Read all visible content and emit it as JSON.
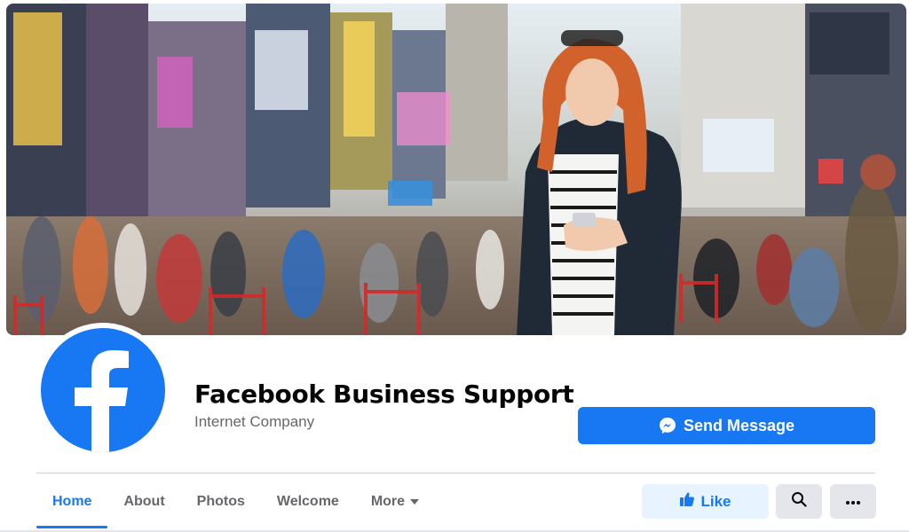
{
  "page": {
    "name": "Facebook Business Support",
    "category": "Internet Company"
  },
  "actions": {
    "send_message": "Send Message",
    "like": "Like"
  },
  "tabs": [
    {
      "label": "Home",
      "active": true
    },
    {
      "label": "About",
      "active": false
    },
    {
      "label": "Photos",
      "active": false
    },
    {
      "label": "Welcome",
      "active": false
    },
    {
      "label": "More",
      "active": false
    }
  ],
  "icons": {
    "send": "messenger-icon",
    "like": "thumbs-up-icon",
    "search": "search-icon",
    "more": "more-dots-icon",
    "more_tab": "caret-down-icon",
    "avatar": "facebook-f-logo"
  },
  "colors": {
    "brand": "#1877f2",
    "text": "#050505",
    "secondary_text": "#65676b",
    "like_bg": "#e7f3ff",
    "icon_button_bg": "#e4e6eb"
  }
}
